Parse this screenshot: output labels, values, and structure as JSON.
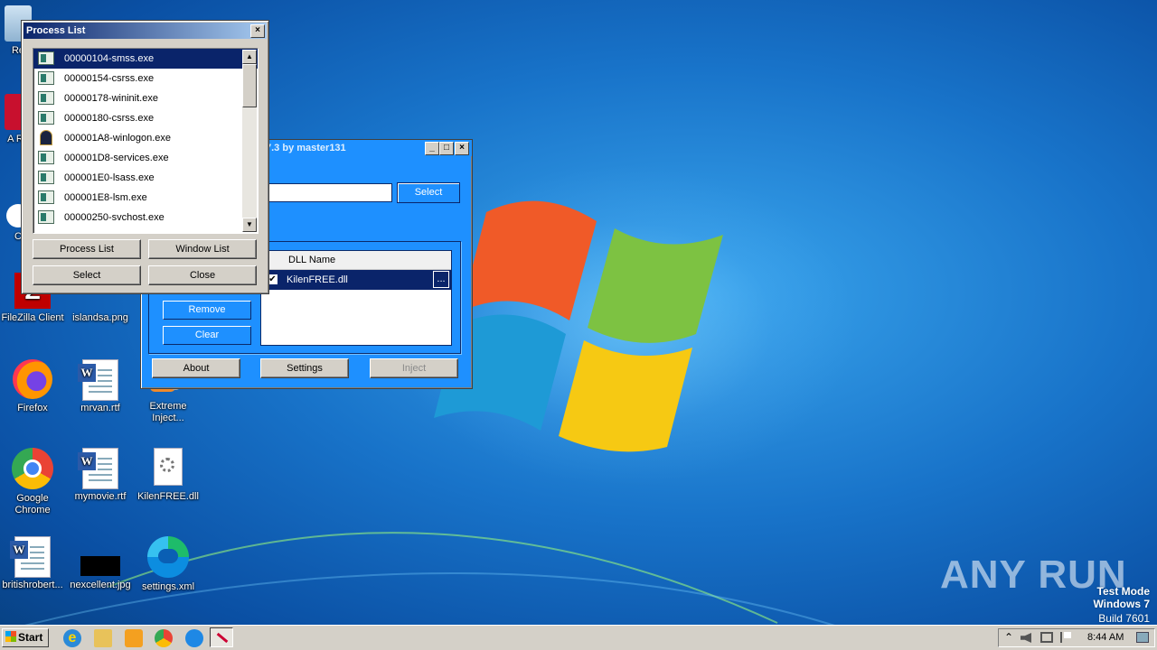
{
  "desktop": {
    "icons": [
      {
        "label": "Re",
        "id": "recycle"
      },
      {
        "label": "A Re",
        "id": "acrobat"
      },
      {
        "label": "C",
        "id": "ccleaner"
      },
      {
        "label": "FileZilla Client",
        "id": "filezilla"
      },
      {
        "label": "islandsa.png",
        "id": "islandsa"
      },
      {
        "label": "Firefox",
        "id": "firefox"
      },
      {
        "label": "mrvan.rtf",
        "id": "mrvan"
      },
      {
        "label": "Extreme Inject...",
        "id": "extreme"
      },
      {
        "label": "Google Chrome",
        "id": "chrome"
      },
      {
        "label": "mymovie.rtf",
        "id": "mymovie"
      },
      {
        "label": "KilenFREE.dll",
        "id": "kilenfree"
      },
      {
        "label": "britishrobert...",
        "id": "britishrobert"
      },
      {
        "label": "nexcellent.jpg",
        "id": "nexcellent"
      },
      {
        "label": "settings.xml",
        "id": "settingsxml"
      }
    ]
  },
  "injector": {
    "title": "7.3 by master131",
    "select_label": "Select",
    "dll_header": "DLL Name",
    "dll_item": "KilenFREE.dll",
    "browse_label": "...",
    "remove_label": "Remove",
    "clear_label": "Clear",
    "about_label": "About",
    "settings_label": "Settings",
    "inject_label": "Inject",
    "path_value": ""
  },
  "process_list": {
    "title": "Process List",
    "items": [
      "00000104-smss.exe",
      "00000154-csrss.exe",
      "00000178-wininit.exe",
      "00000180-csrss.exe",
      "000001A8-winlogon.exe",
      "000001D8-services.exe",
      "000001E0-lsass.exe",
      "000001E8-lsm.exe",
      "00000250-svchost.exe"
    ],
    "selected_index": 0,
    "buttons": {
      "process_list": "Process List",
      "window_list": "Window List",
      "select": "Select",
      "close": "Close"
    },
    "close_glyph": "×"
  },
  "taskbar": {
    "start_label": "Start",
    "clock": "8:44 AM",
    "tray_arrow": "⌃"
  },
  "watermark": {
    "brand": "ANY RUN",
    "line1": "Test Mode",
    "line2": "Windows 7",
    "line3": "Build 7601"
  },
  "colors": {
    "titlebar_active": "#0a246a",
    "injector_bg": "#1e90ff",
    "selection": "#0a246a"
  }
}
